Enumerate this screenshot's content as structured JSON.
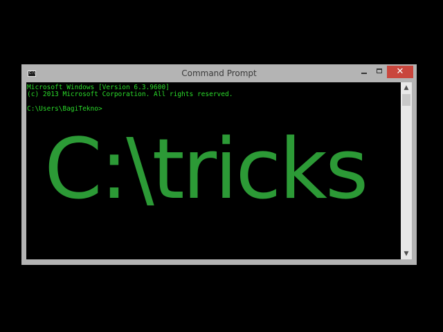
{
  "window": {
    "title": "Command Prompt",
    "icon": "cmd-app-icon",
    "icon_text": "C:\\_",
    "controls": {
      "minimize": "minimize-icon",
      "maximize": "maximize-icon",
      "close_glyph": "✕"
    }
  },
  "console": {
    "lines": [
      "Microsoft Windows [Version 6.3.9600]",
      "(c) 2013 Microsoft Corporation. All rights reserved.",
      "",
      "C:\\Users\\BagiTekno>"
    ],
    "overlay_text": "C:\\tricks"
  },
  "scrollbar": {
    "up_glyph": "▲",
    "down_glyph": "▼"
  },
  "colors": {
    "console_text": "#2bdc2b",
    "overlay_text": "#2c9a36",
    "close_button": "#c9463d",
    "window_frame": "#b4b4b4"
  }
}
